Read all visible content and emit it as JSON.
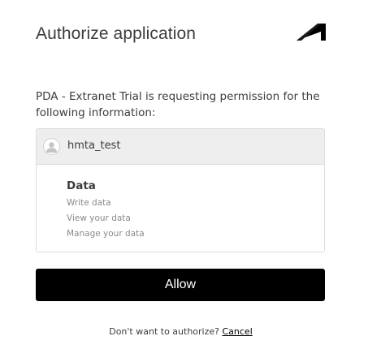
{
  "header": {
    "title": "Authorize application",
    "logo_icon": "autodesk-logo-icon"
  },
  "intro_text": "PDA - Extranet Trial is requesting permission for the following information:",
  "account": {
    "username": "hmta_test",
    "avatar_icon": "user-avatar-icon"
  },
  "scope": {
    "title": "Data",
    "permissions": [
      "Write data",
      "View your data",
      "Manage your data"
    ]
  },
  "actions": {
    "allow_label": "Allow",
    "decline_prompt": "Don't want to authorize?",
    "cancel_label": "Cancel"
  },
  "colors": {
    "primary_button": "#000000",
    "header_bg": "#eeeeee",
    "text": "#3c3c3c",
    "muted_text": "#8a8a8a"
  }
}
